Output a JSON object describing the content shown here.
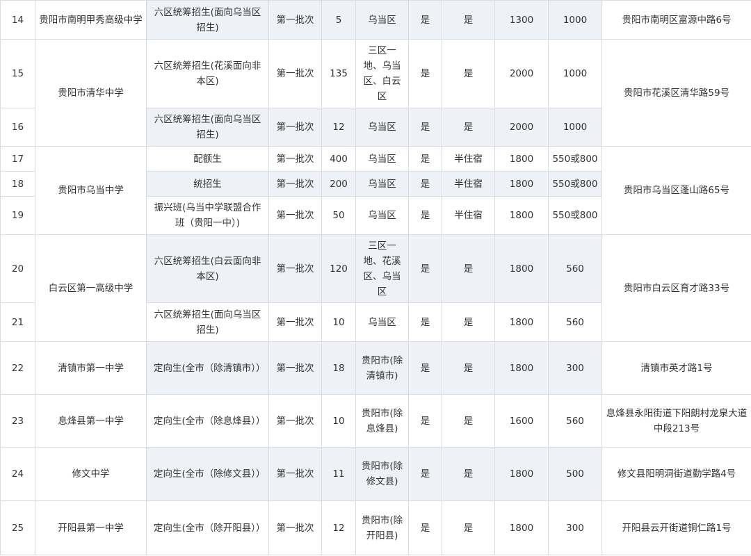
{
  "rows": [
    {
      "no": "14",
      "school": "贵阳市南明甲秀高级中学",
      "type": "六区统筹招生(面向乌当区招生)",
      "batch": "第一批次",
      "count": "5",
      "area": "乌当区",
      "c1": "是",
      "c2": "是",
      "fee1": "1300",
      "fee2": "1000",
      "address": "贵阳市南明区富源中路6号"
    },
    {
      "no": "15",
      "school": "贵阳市清华中学",
      "type": "六区统筹招生(花溪面向非本区)",
      "batch": "第一批次",
      "count": "135",
      "area": "三区一地、乌当区、白云区",
      "c1": "是",
      "c2": "是",
      "fee1": "2000",
      "fee2": "1000",
      "address": "贵阳市花溪区清华路59号"
    },
    {
      "no": "16",
      "type": "六区统筹招生(面向乌当区招生)",
      "batch": "第一批次",
      "count": "12",
      "area": "乌当区",
      "c1": "是",
      "c2": "是",
      "fee1": "2000",
      "fee2": "1000"
    },
    {
      "no": "17",
      "school": "贵阳市乌当中学",
      "type": "配额生",
      "batch": "第一批次",
      "count": "400",
      "area": "乌当区",
      "c1": "是",
      "c2": "半住宿",
      "fee1": "1800",
      "fee2": "550或800",
      "address": "贵阳市乌当区蓬山路65号"
    },
    {
      "no": "18",
      "type": "统招生",
      "batch": "第一批次",
      "count": "200",
      "area": "乌当区",
      "c1": "是",
      "c2": "半住宿",
      "fee1": "1800",
      "fee2": "550或800"
    },
    {
      "no": "19",
      "type": "振兴班(乌当中学联盟合作班（贵阳一中）)",
      "batch": "第一批次",
      "count": "50",
      "area": "乌当区",
      "c1": "是",
      "c2": "半住宿",
      "fee1": "1800",
      "fee2": "550或800"
    },
    {
      "no": "20",
      "school": "白云区第一高级中学",
      "type": "六区统筹招生(白云面向非本区)",
      "batch": "第一批次",
      "count": "120",
      "area": "三区一地、花溪区、乌当区",
      "c1": "是",
      "c2": "是",
      "fee1": "1800",
      "fee2": "560",
      "address": "贵阳市白云区育才路33号"
    },
    {
      "no": "21",
      "type": "六区统筹招生(面向乌当区招生)",
      "batch": "第一批次",
      "count": "10",
      "area": "乌当区",
      "c1": "是",
      "c2": "是",
      "fee1": "1800",
      "fee2": "560"
    },
    {
      "no": "22",
      "school": "清镇市第一中学",
      "type": "定向生(全市（除清镇市））",
      "batch": "第一批次",
      "count": "18",
      "area": "贵阳市(除清镇市)",
      "c1": "是",
      "c2": "是",
      "fee1": "1800",
      "fee2": "300",
      "address": "清镇市英才路1号"
    },
    {
      "no": "23",
      "school": "息烽县第一中学",
      "type": "定向生(全市（除息烽县））",
      "batch": "第一批次",
      "count": "10",
      "area": "贵阳市(除息烽县)",
      "c1": "是",
      "c2": "是",
      "fee1": "1600",
      "fee2": "560",
      "address": "息烽县永阳街道下阳朗村龙泉大道中段213号"
    },
    {
      "no": "24",
      "school": "修文中学",
      "type": "定向生(全市（除修文县））",
      "batch": "第一批次",
      "count": "11",
      "area": "贵阳市(除修文县)",
      "c1": "是",
      "c2": "是",
      "fee1": "1800",
      "fee2": "500",
      "address": "修文县阳明洞街道勤学路4号"
    },
    {
      "no": "25",
      "school": "开阳县第一中学",
      "type": "定向生(全市（除开阳县））",
      "batch": "第一批次",
      "count": "12",
      "area": "贵阳市(除开阳县)",
      "c1": "是",
      "c2": "是",
      "fee1": "1800",
      "fee2": "300",
      "address": "开阳县云开街道铜仁路1号"
    }
  ]
}
